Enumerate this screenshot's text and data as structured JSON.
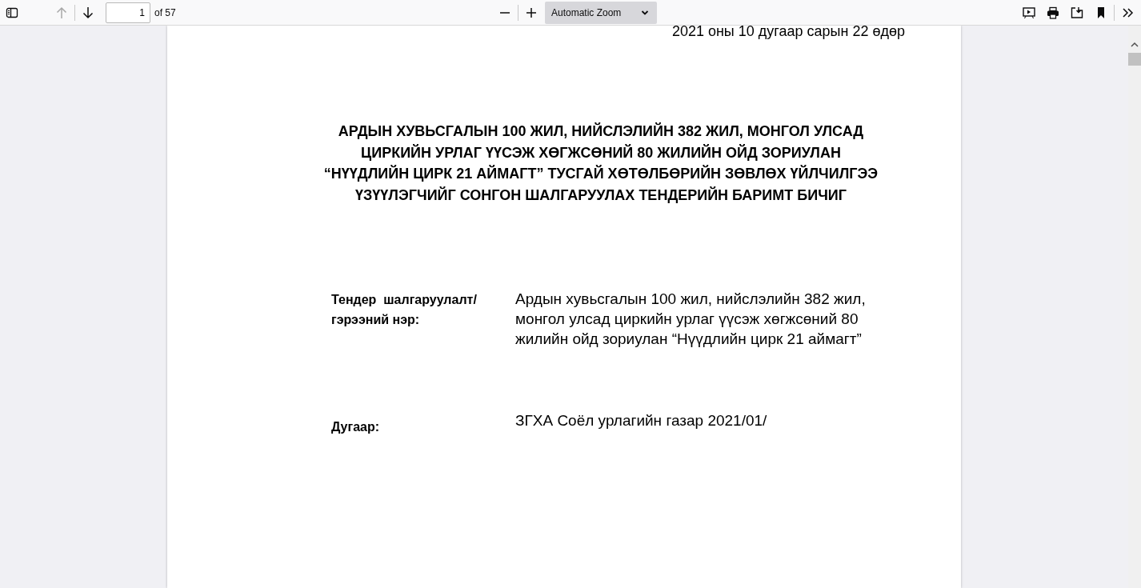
{
  "toolbar": {
    "page_number": "1",
    "page_count": "of 57",
    "zoom": "Automatic Zoom",
    "previous_disabled": true
  },
  "document": {
    "date": "2021 оны 10 дугаар сарын 22 өдөр",
    "title_lines": [
      "АРДЫН ХУВЬСГАЛЫН 100 ЖИЛ, НИЙСЛЭЛИЙН 382 ЖИЛ, МОНГОЛ УЛСАД",
      "ЦИРКИЙН УРЛАГ ҮҮСЭЖ ХӨГЖСӨНИЙ 80 ЖИЛИЙН ОЙД ЗОРИУЛАН",
      "“НҮҮДЛИЙН ЦИРК 21 АЙМАГТ” ТУСГАЙ ХӨТӨЛБӨРИЙН ЗӨВЛӨХ ҮЙЛЧИЛГЭЭ",
      "ҮЗҮҮЛЭГЧИЙГ СОНГОН ШАЛГАРУУЛАХ ТЕНДЕРИЙН БАРИМТ БИЧИГ"
    ],
    "fields": [
      {
        "label_lines": [
          "Тендер  шалгаруулалт/",
          "гэрээний нэр:"
        ],
        "value_lines": [
          "Ардын хувьсгалын 100 жил, нийслэлийн 382 жил,",
          "монгол улсад циркийн урлаг үүсэж хөгжсөний 80",
          "жилийн ойд зориулан “Нүүдлийн цирк 21 аймагт”"
        ]
      },
      {
        "label_lines": [
          "Дугаар:"
        ],
        "value_lines": [
          "ЗГХА Соёл урлагийн газар 2021/01/"
        ]
      }
    ]
  }
}
